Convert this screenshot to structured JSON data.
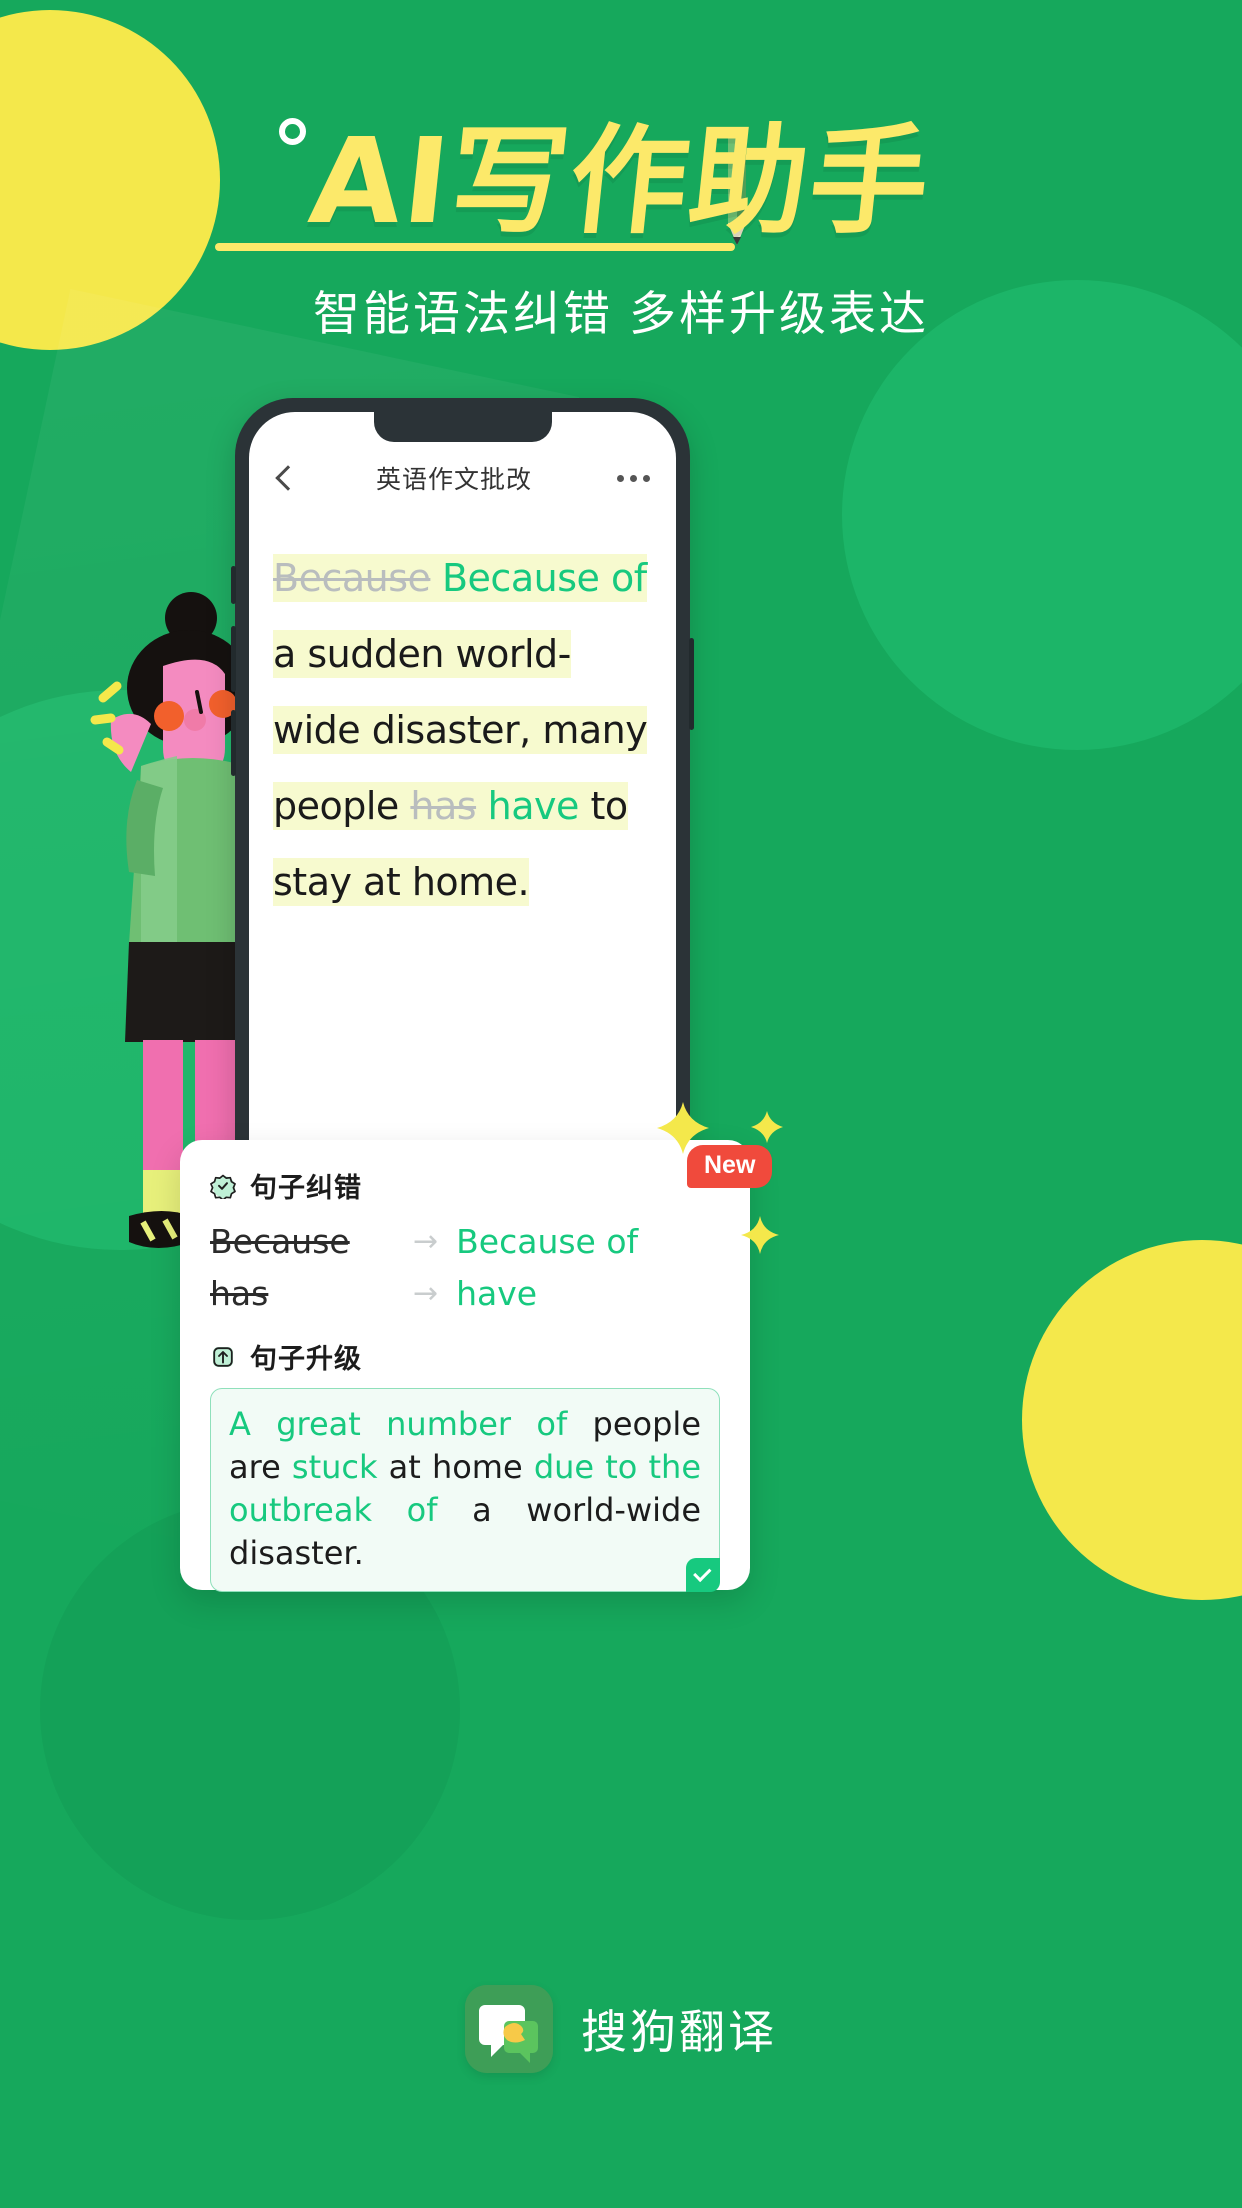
{
  "theme": {
    "bg_green": "#16A85C",
    "accent_yellow": "#FCE96A",
    "mint": "#17C97F",
    "badge_red": "#F04A3C",
    "highlight_yellow": "#F7FACF"
  },
  "header": {
    "title": "AI写作助手",
    "subtitle": "智能语法纠错  多样升级表达",
    "dot_icon": "circle-dot-icon",
    "pencil_icon": "pencil-icon"
  },
  "phone": {
    "app_bar": {
      "back_icon": "back-chevron-icon",
      "title": "英语作文批改",
      "more_icon": "more-dots-icon"
    },
    "essay_lines": [
      {
        "strike": "Because",
        "fix": "Because",
        "plain": ""
      },
      {
        "strike": "",
        "fix": "of",
        "plain": " a sudden world-"
      },
      {
        "strike": "",
        "fix": "",
        "plain": "wide disaster, many"
      },
      {
        "strike": "has",
        "fix": "have",
        "plain": "people  to",
        "prefix": "people "
      },
      {
        "strike": "",
        "fix": "",
        "plain": "stay at home."
      }
    ],
    "essay_text": "Because Because of a sudden world-wide disaster, many people has have to stay at home."
  },
  "card": {
    "correction": {
      "icon": "check-target-icon",
      "title": "句子纠错",
      "arrow_glyph": "→",
      "rows": [
        {
          "from": "Because",
          "to": "Because of"
        },
        {
          "from": "has",
          "to": "have"
        }
      ]
    },
    "upgrade": {
      "icon": "upgrade-arrow-box-icon",
      "title": "句子升级",
      "check_icon": "check-mark-icon",
      "segments": [
        {
          "text": "A great number of ",
          "highlight": true
        },
        {
          "text": "people are ",
          "highlight": false
        },
        {
          "text": "stuck ",
          "highlight": true
        },
        {
          "text": "at home ",
          "highlight": false
        },
        {
          "text": "due to the outbreak of ",
          "highlight": true
        },
        {
          "text": "a world-wide disaster.",
          "highlight": false
        }
      ],
      "full_text": "A great number of people are stuck at home due to the outbreak of a world-wide disaster."
    }
  },
  "badge": {
    "label": "New",
    "sparkle_icon": "sparkle-icon"
  },
  "brand": {
    "logo_icon": "sogou-translate-logo",
    "name": "搜狗翻译"
  }
}
